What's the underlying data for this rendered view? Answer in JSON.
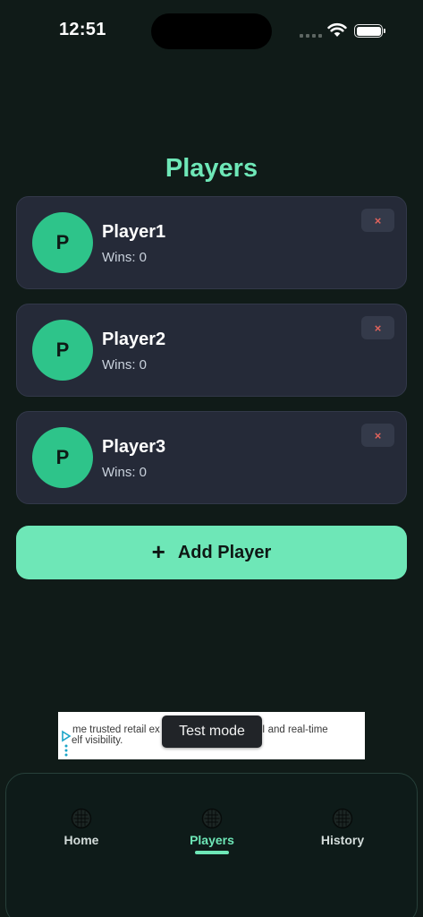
{
  "status_bar": {
    "time": "12:51"
  },
  "page": {
    "title": "Players"
  },
  "players": [
    {
      "initial": "P",
      "name": "Player1",
      "wins": "Wins: 0",
      "remove_label": "×"
    },
    {
      "initial": "P",
      "name": "Player2",
      "wins": "Wins: 0",
      "remove_label": "×"
    },
    {
      "initial": "P",
      "name": "Player3",
      "wins": "Wins: 0",
      "remove_label": "×"
    }
  ],
  "add_button": {
    "icon": "+",
    "label": "Add Player"
  },
  "ad": {
    "line1": "me trusted retail ex",
    "line1b": "by AI and real-time",
    "line2": "elf visibility.",
    "toast": "Test mode"
  },
  "tabs": [
    {
      "label": "Home",
      "icon": "ball-icon",
      "active": false
    },
    {
      "label": "Players",
      "icon": "ball-icon",
      "active": true
    },
    {
      "label": "History",
      "icon": "ball-icon",
      "active": false
    }
  ],
  "colors": {
    "background": "#101b18",
    "accent": "#6ee7b7",
    "card": "#252a38",
    "avatar": "#2ec48a",
    "remove": "#e0635c"
  }
}
